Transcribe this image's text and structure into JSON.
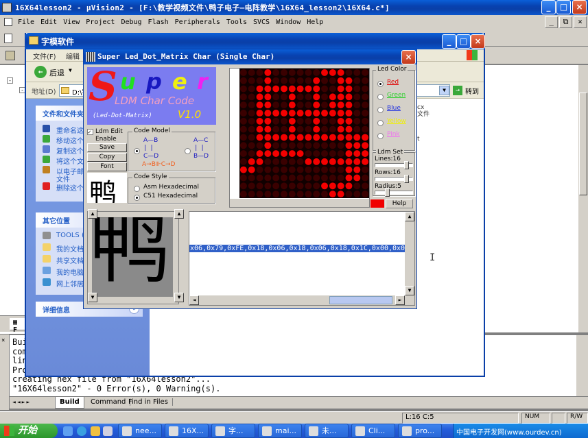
{
  "ide": {
    "title": "16X64lesson2  - μVision2 - [F:\\教学视频文件\\鸭子电子—电阵教学\\16X64_lesson2\\16X64.c*]",
    "menu": [
      "File",
      "Edit",
      "View",
      "Project",
      "Debug",
      "Flash",
      "Peripherals",
      "Tools",
      "SVCS",
      "Window",
      "Help"
    ],
    "output_lines": [
      "Buil",
      "com",
      "lin",
      "Pro",
      "creating hex file from \"16X64lesson2\"...",
      "\"16X64lesson2\" - 0 Error(s), 0 Warning(s)."
    ],
    "output_tabs": [
      "Build",
      "Command",
      "Find in Files"
    ],
    "status_pos": "L:16 C:5",
    "status_num": "NUM",
    "status_rw": "R/W",
    "side_tab": "F"
  },
  "explorer": {
    "title": "字模软件",
    "menu": [
      "文件(F)",
      "编辑"
    ],
    "back_label": "后退",
    "address_label": "地址(D)",
    "address_value": "D:\\字",
    "go_label": "转到",
    "tasks_header": "文件和文件夹",
    "tasks": [
      "重命名这",
      "移动这个",
      "复制这个",
      "将这个文",
      "以电子邮件",
      "删除这个"
    ],
    "tasks_extra": "文件",
    "places_header": "其它位置",
    "places": [
      "TOOLS (D",
      "我的文档",
      "共享文档",
      "我的电脑",
      "网上邻居"
    ],
    "details_header": "详细信息",
    "right_text": [
      "cx",
      "文件",
      "t"
    ]
  },
  "dialog": {
    "title": "Super Led_Dot_Matrix Char (Single Char)",
    "logo_super": "Super",
    "logo_ldm": "LDM Char Code",
    "logo_sub": "(Led-Dot-Matrix)",
    "logo_ver": "V1.0",
    "ldm_edit": "Ldm Edit",
    "enable": "Enable",
    "save": "Save",
    "copy": "Copy",
    "font": "Font",
    "char": "鸭",
    "code_model": "Code Model",
    "cm_a": "A—B",
    "cm_c": "C—D",
    "cm_ac": "A—C",
    "cm_bd": "B—D",
    "cm_flow": "A→B⊪C→D",
    "code_style": "Code Style",
    "cs_asm": "Asm Hexadecimal",
    "cs_c51": "C51 Hexadecimal",
    "led_color_label": "Led Color",
    "colors": [
      {
        "name": "Red",
        "color": "#e00000"
      },
      {
        "name": "Green",
        "color": "#2ad02a"
      },
      {
        "name": "Blue",
        "color": "#2030e0"
      },
      {
        "name": "Yellow",
        "color": "#f0f000"
      },
      {
        "name": "Pink",
        "color": "#f070f0"
      }
    ],
    "ldm_set": "Ldm Set",
    "lines": "Lines:16",
    "rows": "Rows:16",
    "radius": "Radius:5",
    "help": "Help",
    "hex_output": "x06,0x79,0xFE,0x18,0x06,0x18,0x06,0x18,0x1C,0x00,0x00"
  },
  "taskbar": {
    "start": "开始",
    "items": [
      "nee...",
      "16X...",
      "字...",
      "mai...",
      "未...",
      "Cli...",
      "pro..."
    ],
    "watermark": "中国电子开发网(www.ourdev.cn)"
  }
}
